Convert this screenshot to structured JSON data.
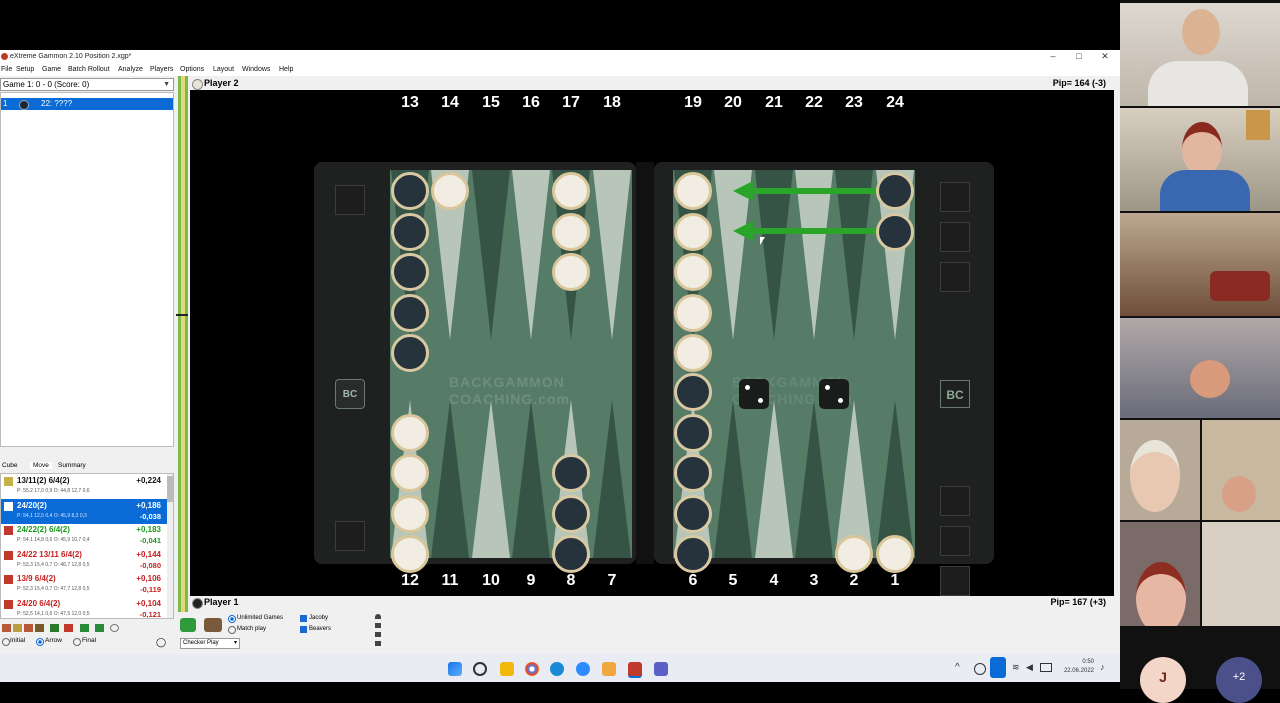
{
  "window": {
    "title": "eXtreme Gammon 2.10 Position 2.xgp*",
    "controls": [
      "–",
      "□",
      "✕"
    ]
  },
  "menu": [
    "File",
    "Setup",
    "Game",
    "Batch Rollout",
    "Analyze",
    "Players",
    "Options",
    "Layout",
    "Windows",
    "Help"
  ],
  "left_panel": {
    "game_selector": "Game 1: 0 - 0 (Score: 0)",
    "selected_move": {
      "num": "1",
      "text": "22: ????"
    },
    "tabs": [
      "Cube",
      "Move",
      "Summary"
    ],
    "analysis": [
      {
        "move": "13/11(2) 6/4(2)",
        "equity": "+0,224",
        "delta": "",
        "probs": "P: 55,2 17,0 0,9   O: 44,8 12,7 0,6",
        "color": "#111111",
        "selected": false
      },
      {
        "move": "24/20(2)",
        "equity": "+0,186",
        "delta": "-0,038",
        "probs": "P: 54,1 12,5 0,4   O: 45,9 8,3 0,3",
        "color": "#ffffff",
        "selected": true
      },
      {
        "move": "24/22(2) 6/4(2)",
        "equity": "+0,183",
        "delta": "-0,041",
        "probs": "P: 54,1 14,8 0,6   O: 45,9 10,7 0,4",
        "color": "#1a9a1a",
        "selected": false
      },
      {
        "move": "24/22 13/11 6/4(2)",
        "equity": "+0,144",
        "delta": "-0,080",
        "probs": "P: 53,3 15,4 0,7   O: 46,7 12,8 0,5",
        "color": "#c81e1e",
        "selected": false
      },
      {
        "move": "13/9 6/4(2)",
        "equity": "+0,106",
        "delta": "-0,119",
        "probs": "P: 52,3 15,4 0,7   O: 47,7 12,8 0,5",
        "color": "#c81e1e",
        "selected": false
      },
      {
        "move": "24/20 6/4(2)",
        "equity": "+0,104",
        "delta": "-0,121",
        "probs": "P: 52,5 14,1 0,6   O: 47,5 12,0 0,5",
        "color": "#c81e1e",
        "selected": false
      }
    ],
    "display_options": [
      "Initial",
      "Arrow",
      "Final"
    ],
    "display_selected": "Arrow"
  },
  "board": {
    "player_top": "Player 2",
    "pip_top": "Pip= 164 (-3)",
    "player_bottom": "Player 1",
    "pip_bottom": "Pip= 167 (+3)",
    "top_numbers": [
      "13",
      "14",
      "15",
      "16",
      "17",
      "18",
      "19",
      "20",
      "21",
      "22",
      "23",
      "24"
    ],
    "bottom_numbers": [
      "12",
      "11",
      "10",
      "9",
      "8",
      "7",
      "6",
      "5",
      "4",
      "3",
      "2",
      "1"
    ],
    "logo_line1": "BACKGAMMON",
    "logo_line2": "COACHING.com",
    "badge": "BC",
    "dice": [
      2,
      2
    ],
    "arrow_color": "#2aa52a"
  },
  "controls": {
    "play_modes": [
      "Unlimited Games",
      "Match play"
    ],
    "play_mode_selected": "Unlimited Games",
    "checks": [
      "Jacoby",
      "Beavers"
    ],
    "mode_select": "Checker Play"
  },
  "taskbar": {
    "time": "0:50",
    "date": "22.06.2022"
  },
  "video": {
    "avatar_initial": "J",
    "more_count": "+2"
  }
}
